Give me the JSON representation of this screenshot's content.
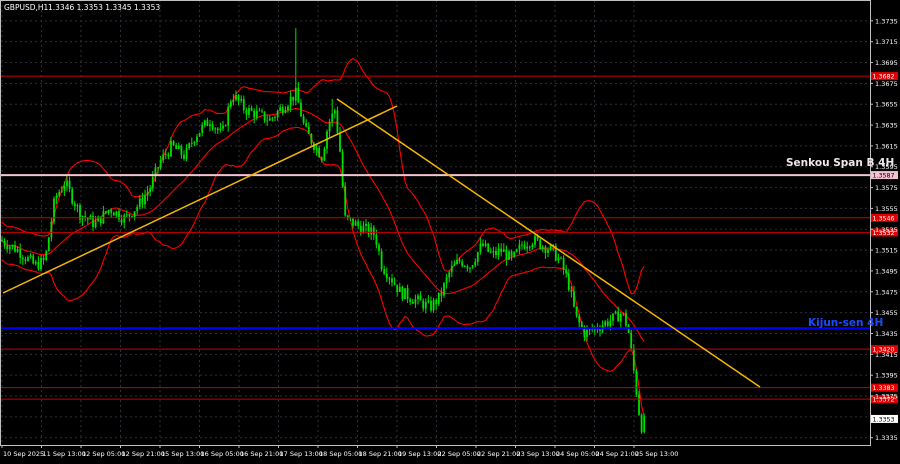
{
  "header": {
    "symbol": "GBPUSD,H1",
    "ohlc": "1.3346 1.3353 1.3345 1.3353"
  },
  "colors": {
    "background": "#000000",
    "grid": "#2a2f3a",
    "candle": "#00e000",
    "bollinger": "#ff0000",
    "level_line": "#cc0000",
    "trendline": "#f5b800",
    "senkou_line": "#f4c2d0",
    "kijun_line": "#0000ff",
    "axis_text": "#ffffff"
  },
  "chart_data": {
    "type": "candlestick",
    "y_axis_ticks": [
      "1.3735",
      "1.3715",
      "1.3695",
      "1.3675",
      "1.3655",
      "1.3635",
      "1.3615",
      "1.3595",
      "1.3575",
      "1.3555",
      "1.3535",
      "1.3515",
      "1.3495",
      "1.3475",
      "1.3455",
      "1.3435",
      "1.3415",
      "1.3395",
      "1.3375",
      "1.3355",
      "1.3335"
    ],
    "x_axis_ticks": [
      "10 Sep 2025",
      "11 Sep 13:00",
      "12 Sep 05:00",
      "12 Sep 21:00",
      "15 Sep 13:00",
      "16 Sep 05:00",
      "16 Sep 21:00",
      "17 Sep 13:00",
      "18 Sep 05:00",
      "18 Sep 21:00",
      "19 Sep 13:00",
      "22 Sep 05:00",
      "22 Sep 21:00",
      "23 Sep 13:00",
      "24 Sep 05:00",
      "24 Sep 21:00",
      "25 Sep 13:00"
    ],
    "ylim": [
      1.3328,
      1.3755
    ],
    "levels": [
      {
        "value": 1.3682,
        "label": "1.3682",
        "type": "resistance"
      },
      {
        "value": 1.3587,
        "label": "1.3587",
        "type": "senkou",
        "name": "Senkou Span B 4H"
      },
      {
        "value": 1.3546,
        "label": "1.3546",
        "type": "resistance"
      },
      {
        "value": 1.3532,
        "label": "1.3532",
        "type": "resistance"
      },
      {
        "value": 1.344,
        "label": "",
        "type": "kijun",
        "name": "Kijun-sen 4H"
      },
      {
        "value": 1.342,
        "label": "1.3420",
        "type": "support"
      },
      {
        "value": 1.3383,
        "label": "1.3383",
        "type": "support"
      },
      {
        "value": 1.3372,
        "label": "1.3372",
        "type": "support"
      }
    ],
    "current_price": "1.3353",
    "annotations": [
      "Senkou Span B 4H",
      "Kijun-sen 4H"
    ]
  }
}
